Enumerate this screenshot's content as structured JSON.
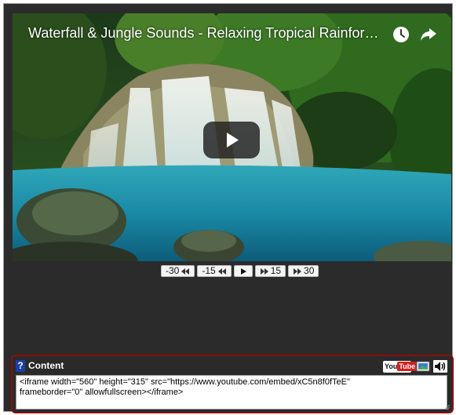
{
  "video": {
    "title": "Waterfall & Jungle Sounds - Relaxing Tropical Rainfores...",
    "watch_later_icon": "clock-icon",
    "share_icon": "share-arrow-icon",
    "play_icon": "play-icon"
  },
  "skip_controls": [
    {
      "label": "-30",
      "icon": "rewind-icon",
      "icon_after": true
    },
    {
      "label": "-15",
      "icon": "rewind-icon",
      "icon_after": true
    },
    {
      "label": "",
      "icon": "play-icon"
    },
    {
      "label": "15",
      "icon": "forward-icon",
      "icon_after": false
    },
    {
      "label": "30",
      "icon": "forward-icon",
      "icon_after": false
    }
  ],
  "content_panel": {
    "help_label": "?",
    "label": "Content",
    "youtube_you": "You",
    "youtube_tube": "Tube",
    "embed_code": "<iframe width=\"560\" height=\"315\" src=\"https://www.youtube.com/embed/xC5n8f0fTeE\"\nframeborder=\"0\" allowfullscreen></iframe>"
  },
  "colors": {
    "panel_border": "#8b0e0e",
    "background": "#2b2b2b",
    "youtube_red": "#d6201e"
  }
}
